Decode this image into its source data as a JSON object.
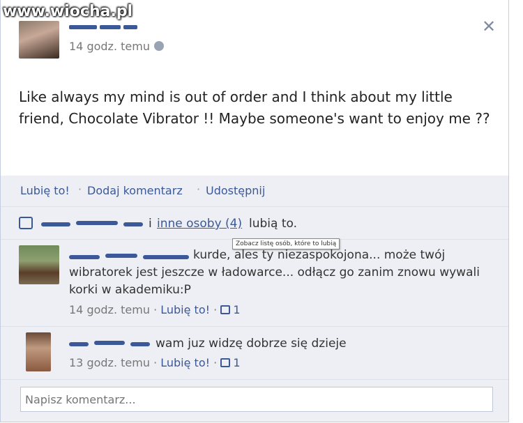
{
  "watermark": "www.wiocha.pl",
  "post": {
    "timestamp": "14 godz. temu",
    "text": "Like always my mind is out of order and I think about my little friend, Chocolate Vibrator !! Maybe someone's want to enjoy me ??"
  },
  "actions": {
    "like": "Lubię to!",
    "comment": "Dodaj komentarz",
    "share": "Udostępnij",
    "separator": "·"
  },
  "likes": {
    "prefix_tail": "i",
    "others_link": "inne osoby (4)",
    "suffix": "lubią to.",
    "tooltip": "Zobacz listę osób, które to lubią"
  },
  "comments": [
    {
      "text": "kurde, ales ty niezaspokojona... może twój wibratorek jest jeszcze w ładowarce... odłącz go zanim znowu wywali korki w akademiku:P",
      "timestamp": "14 godz. temu",
      "like": "Lubię to!",
      "like_count": "1"
    },
    {
      "text": "wam juz widzę dobrze się dzieje",
      "timestamp": "13 godz. temu",
      "like": "Lubię to!",
      "like_count": "1"
    }
  ],
  "composer": {
    "placeholder": "Napisz komentarz..."
  },
  "colors": {
    "link": "#3b5998",
    "panel": "#edeff4"
  }
}
